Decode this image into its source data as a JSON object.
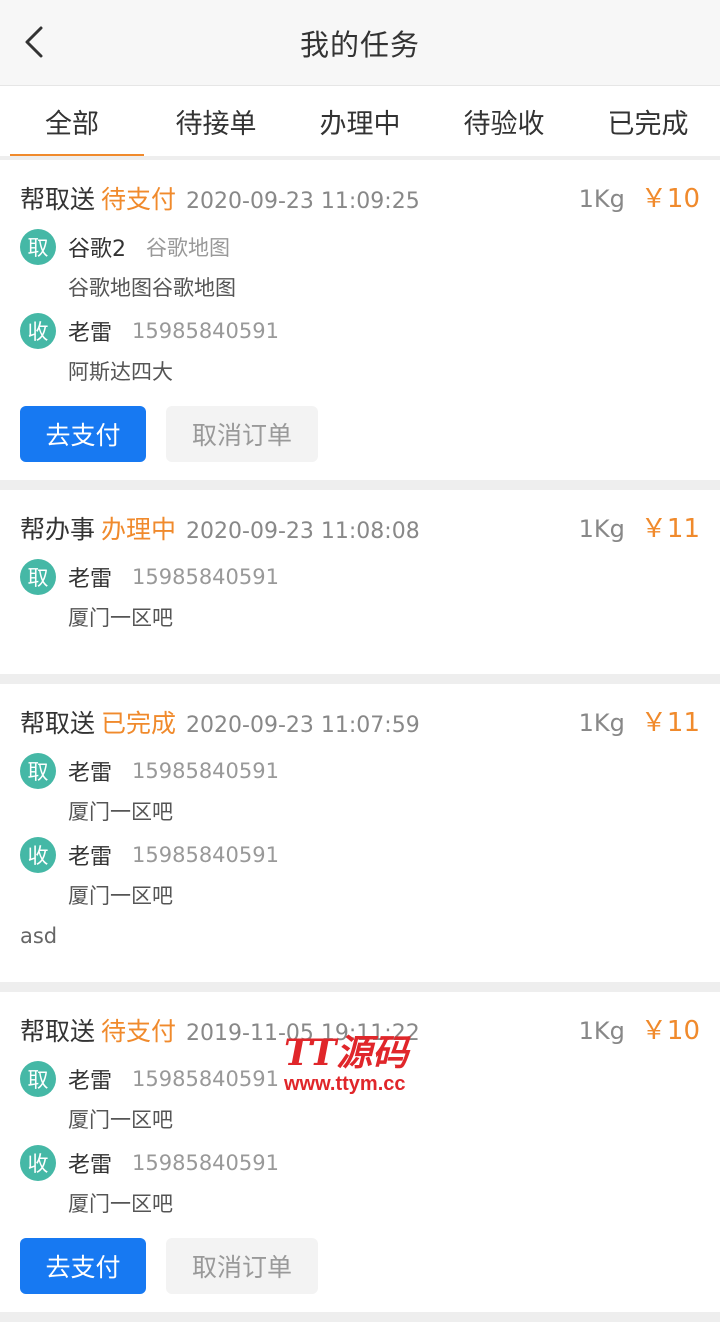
{
  "header": {
    "title": "我的任务",
    "back_icon": "chevron-left-icon"
  },
  "tabs": [
    {
      "label": "全部",
      "active": true
    },
    {
      "label": "待接单",
      "active": false
    },
    {
      "label": "办理中",
      "active": false
    },
    {
      "label": "待验收",
      "active": false
    },
    {
      "label": "已完成",
      "active": false
    }
  ],
  "colors": {
    "accent": "#f08a2c",
    "badge": "#45b8a6",
    "primary_button": "#1779f2"
  },
  "tasks": [
    {
      "type": "帮取送",
      "status": "待支付",
      "time": "2020-09-23 11:09:25",
      "weight": "1Kg",
      "price": "￥10",
      "pickup": {
        "badge": "取",
        "name": "谷歌2",
        "sub": "谷歌地图",
        "detail": "谷歌地图谷歌地图"
      },
      "receive": {
        "badge": "收",
        "name": "老雷",
        "sub": "15985840591",
        "detail": "阿斯达四大"
      },
      "buttons": {
        "pay": "去支付",
        "cancel": "取消订单"
      }
    },
    {
      "type": "帮办事",
      "status": "办理中",
      "time": "2020-09-23 11:08:08",
      "weight": "1Kg",
      "price": "￥11",
      "pickup": {
        "badge": "取",
        "name": "老雷",
        "sub": "15985840591",
        "detail": "厦门一区吧"
      }
    },
    {
      "type": "帮取送",
      "status": "已完成",
      "time": "2020-09-23 11:07:59",
      "weight": "1Kg",
      "price": "￥11",
      "pickup": {
        "badge": "取",
        "name": "老雷",
        "sub": "15985840591",
        "detail": "厦门一区吧"
      },
      "receive": {
        "badge": "收",
        "name": "老雷",
        "sub": "15985840591",
        "detail": "厦门一区吧"
      },
      "remark": "asd"
    },
    {
      "type": "帮取送",
      "status": "待支付",
      "time": "2019-11-05 19:11:22",
      "weight": "1Kg",
      "price": "￥10",
      "pickup": {
        "badge": "取",
        "name": "老雷",
        "sub": "15985840591",
        "detail": "厦门一区吧"
      },
      "receive": {
        "badge": "收",
        "name": "老雷",
        "sub": "15985840591",
        "detail": "厦门一区吧"
      },
      "buttons": {
        "pay": "去支付",
        "cancel": "取消订单"
      }
    }
  ],
  "watermark": {
    "main": "TT源码",
    "sub": "www.ttym.cc"
  }
}
